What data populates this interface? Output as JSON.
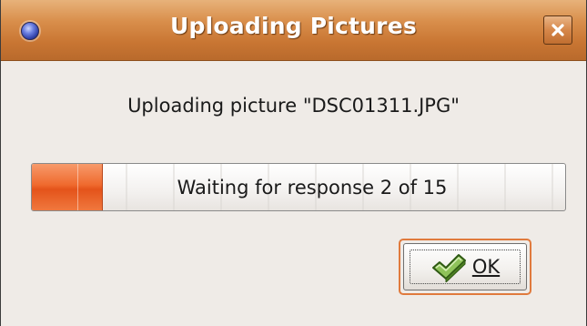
{
  "window": {
    "title": "Uploading Pictures",
    "title_icon": "app-icon",
    "close_icon": "close-icon"
  },
  "dialog": {
    "message": "Uploading picture \"DSC01311.JPG\""
  },
  "progress": {
    "text": "Waiting for response 2 of 15",
    "current": 2,
    "total": 15,
    "fraction": 0.1333,
    "fill_color": "#ef6a2e"
  },
  "buttons": {
    "ok_label": "OK",
    "ok_icon": "ok-check-icon"
  },
  "colors": {
    "titlebar": "#d98f4c",
    "focus_ring": "#e07a3d",
    "background": "#efebe7"
  }
}
